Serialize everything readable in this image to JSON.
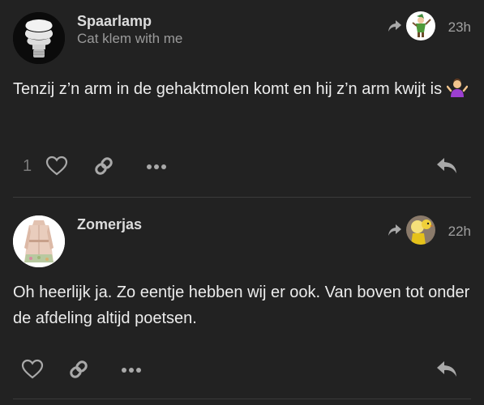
{
  "posts": [
    {
      "username": "Spaarlamp",
      "subtitle": "Cat klem with me",
      "time": "23h",
      "text": "Tenzij z’n arm in de gehaktmolen komt en hij z’n arm kwijt is",
      "emoji": "person-shrugging-emoji",
      "like_count": "1",
      "avatar": "light-bulb-icon",
      "reply_to_avatar": "robin-hood-avatar"
    },
    {
      "username": "Zomerjas",
      "subtitle": "",
      "time": "22h",
      "text": "Oh heerlijk ja. Zo eentje hebben wij er ook. Van boven tot onder de afdeling altijd poetsen.",
      "like_count": "",
      "avatar": "trench-coat-avatar",
      "reply_to_avatar": "yellow-duck-avatar"
    }
  ],
  "icons": {
    "reply_to": "share-arrow-icon",
    "like": "heart-icon",
    "link": "link-icon",
    "more": "ellipsis-icon",
    "reply": "reply-icon"
  },
  "colors": {
    "background": "#222222",
    "text": "#ececec",
    "muted": "#9a9a9a",
    "icon": "#a9a9a9"
  }
}
